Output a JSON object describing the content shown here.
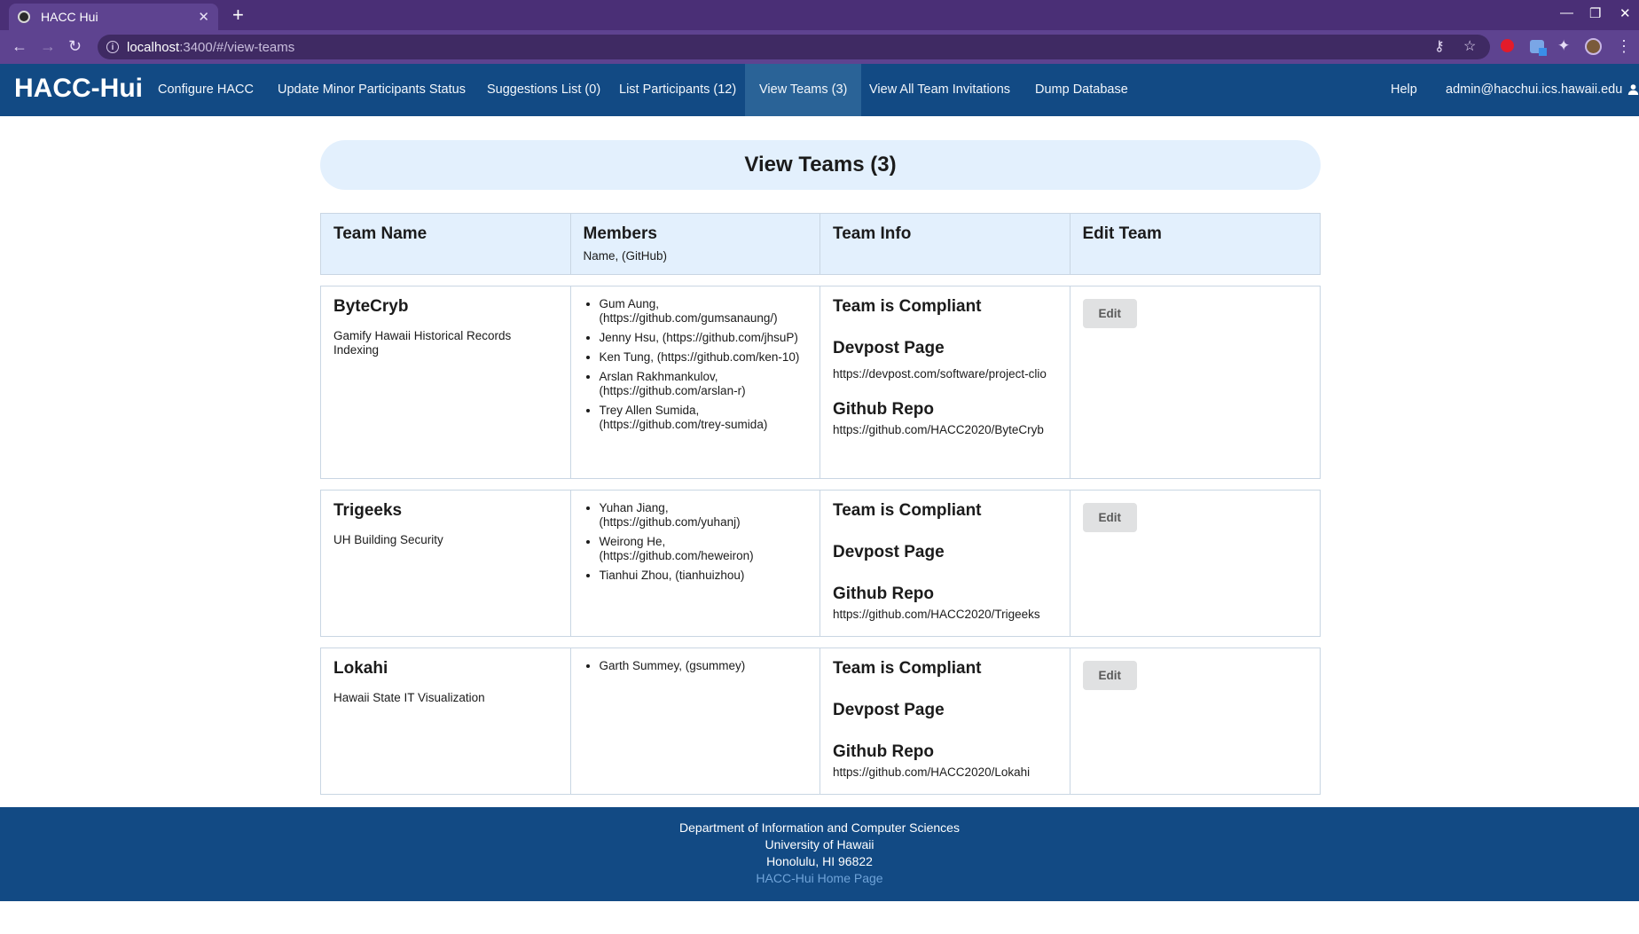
{
  "browser": {
    "tab_title": "HACC Hui",
    "url_host": "localhost",
    "url_path": ":3400/#/view-teams"
  },
  "nav": {
    "brand": "HACC-Hui",
    "items": [
      "Configure HACC",
      "Update Minor Participants Status",
      "Suggestions List (0)",
      "List Participants (12)",
      "View Teams (3)",
      "View All Team Invitations",
      "Dump Database"
    ],
    "help": "Help",
    "user": "admin@hacchui.ics.hawaii.edu"
  },
  "page": {
    "title": "View Teams (3)",
    "columns": {
      "team_name": "Team Name",
      "members": "Members",
      "members_sub": "Name, (GitHub)",
      "team_info": "Team Info",
      "edit_team": "Edit Team"
    }
  },
  "teams": [
    {
      "name": "ByteCryb",
      "challenge": "Gamify Hawaii Historical Records Indexing",
      "members": [
        "Gum Aung, (https://github.com/gumsanaung/)",
        "Jenny Hsu, (https://github.com/jhsuP)",
        "Ken Tung, (https://github.com/ken-10)",
        "Arslan Rakhmankulov, (https://github.com/arslan-r)",
        "Trey Allen Sumida, (https://github.com/trey-sumida)"
      ],
      "compliance": "Team is Compliant",
      "devpost_label": "Devpost Page",
      "devpost": "https://devpost.com/software/project-clio",
      "github_label": "Github Repo",
      "github": "https://github.com/HACC2020/ByteCryb",
      "edit_label": "Edit"
    },
    {
      "name": "Trigeeks",
      "challenge": "UH Building Security",
      "members": [
        "Yuhan Jiang, (https://github.com/yuhanj)",
        "Weirong He, (https://github.com/heweiron)",
        "Tianhui Zhou, (tianhuizhou)"
      ],
      "compliance": "Team is Compliant",
      "devpost_label": "Devpost Page",
      "github_label": "Github Repo",
      "github": "https://github.com/HACC2020/Trigeeks",
      "edit_label": "Edit"
    },
    {
      "name": "Lokahi",
      "challenge": "Hawaii State IT Visualization",
      "members": [
        "Garth Summey, (gsummey)"
      ],
      "compliance": "Team is Compliant",
      "devpost_label": "Devpost Page",
      "github_label": "Github Repo",
      "github": "https://github.com/HACC2020/Lokahi",
      "edit_label": "Edit"
    }
  ],
  "footer": {
    "line1": "Department of Information and Computer Sciences",
    "line2": "University of Hawaii",
    "line3": "Honolulu, HI 96822",
    "link": "HACC-Hui Home Page"
  }
}
